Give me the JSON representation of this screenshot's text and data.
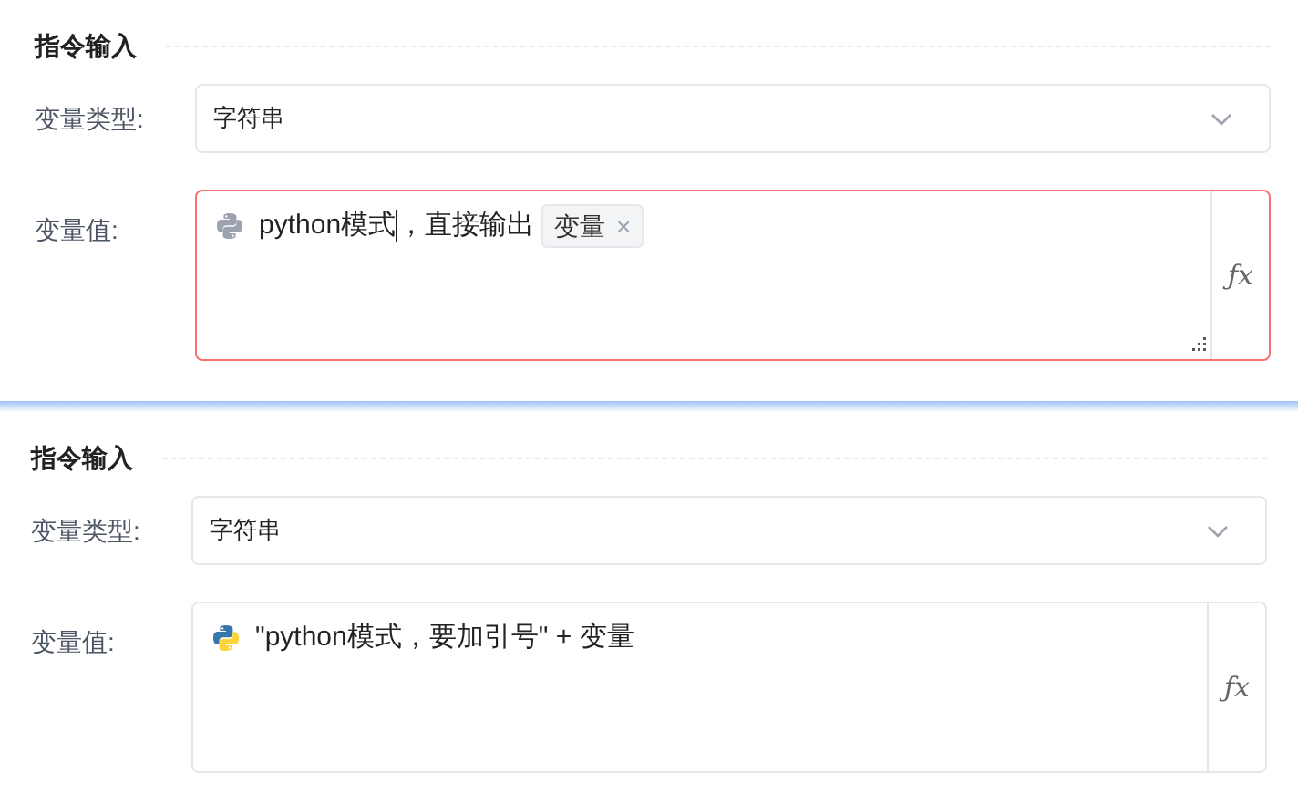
{
  "panels": [
    {
      "title": "指令输入",
      "type_label": "变量类型:",
      "type_value": "字符串",
      "value_label": "变量值:",
      "python_active": false,
      "error": true,
      "fx": "ƒx",
      "value_parts": [
        {
          "kind": "text",
          "text": "python模式"
        },
        {
          "kind": "caret"
        },
        {
          "kind": "text",
          "text": "，直接输出"
        },
        {
          "kind": "tag",
          "text": "变量",
          "close": "×"
        }
      ]
    },
    {
      "title": "指令输入",
      "type_label": "变量类型:",
      "type_value": "字符串",
      "value_label": "变量值:",
      "python_active": true,
      "error": false,
      "fx": "ƒx",
      "value_parts": [
        {
          "kind": "text",
          "text": "\"python模式，要加引号\" + 变量"
        }
      ]
    }
  ]
}
